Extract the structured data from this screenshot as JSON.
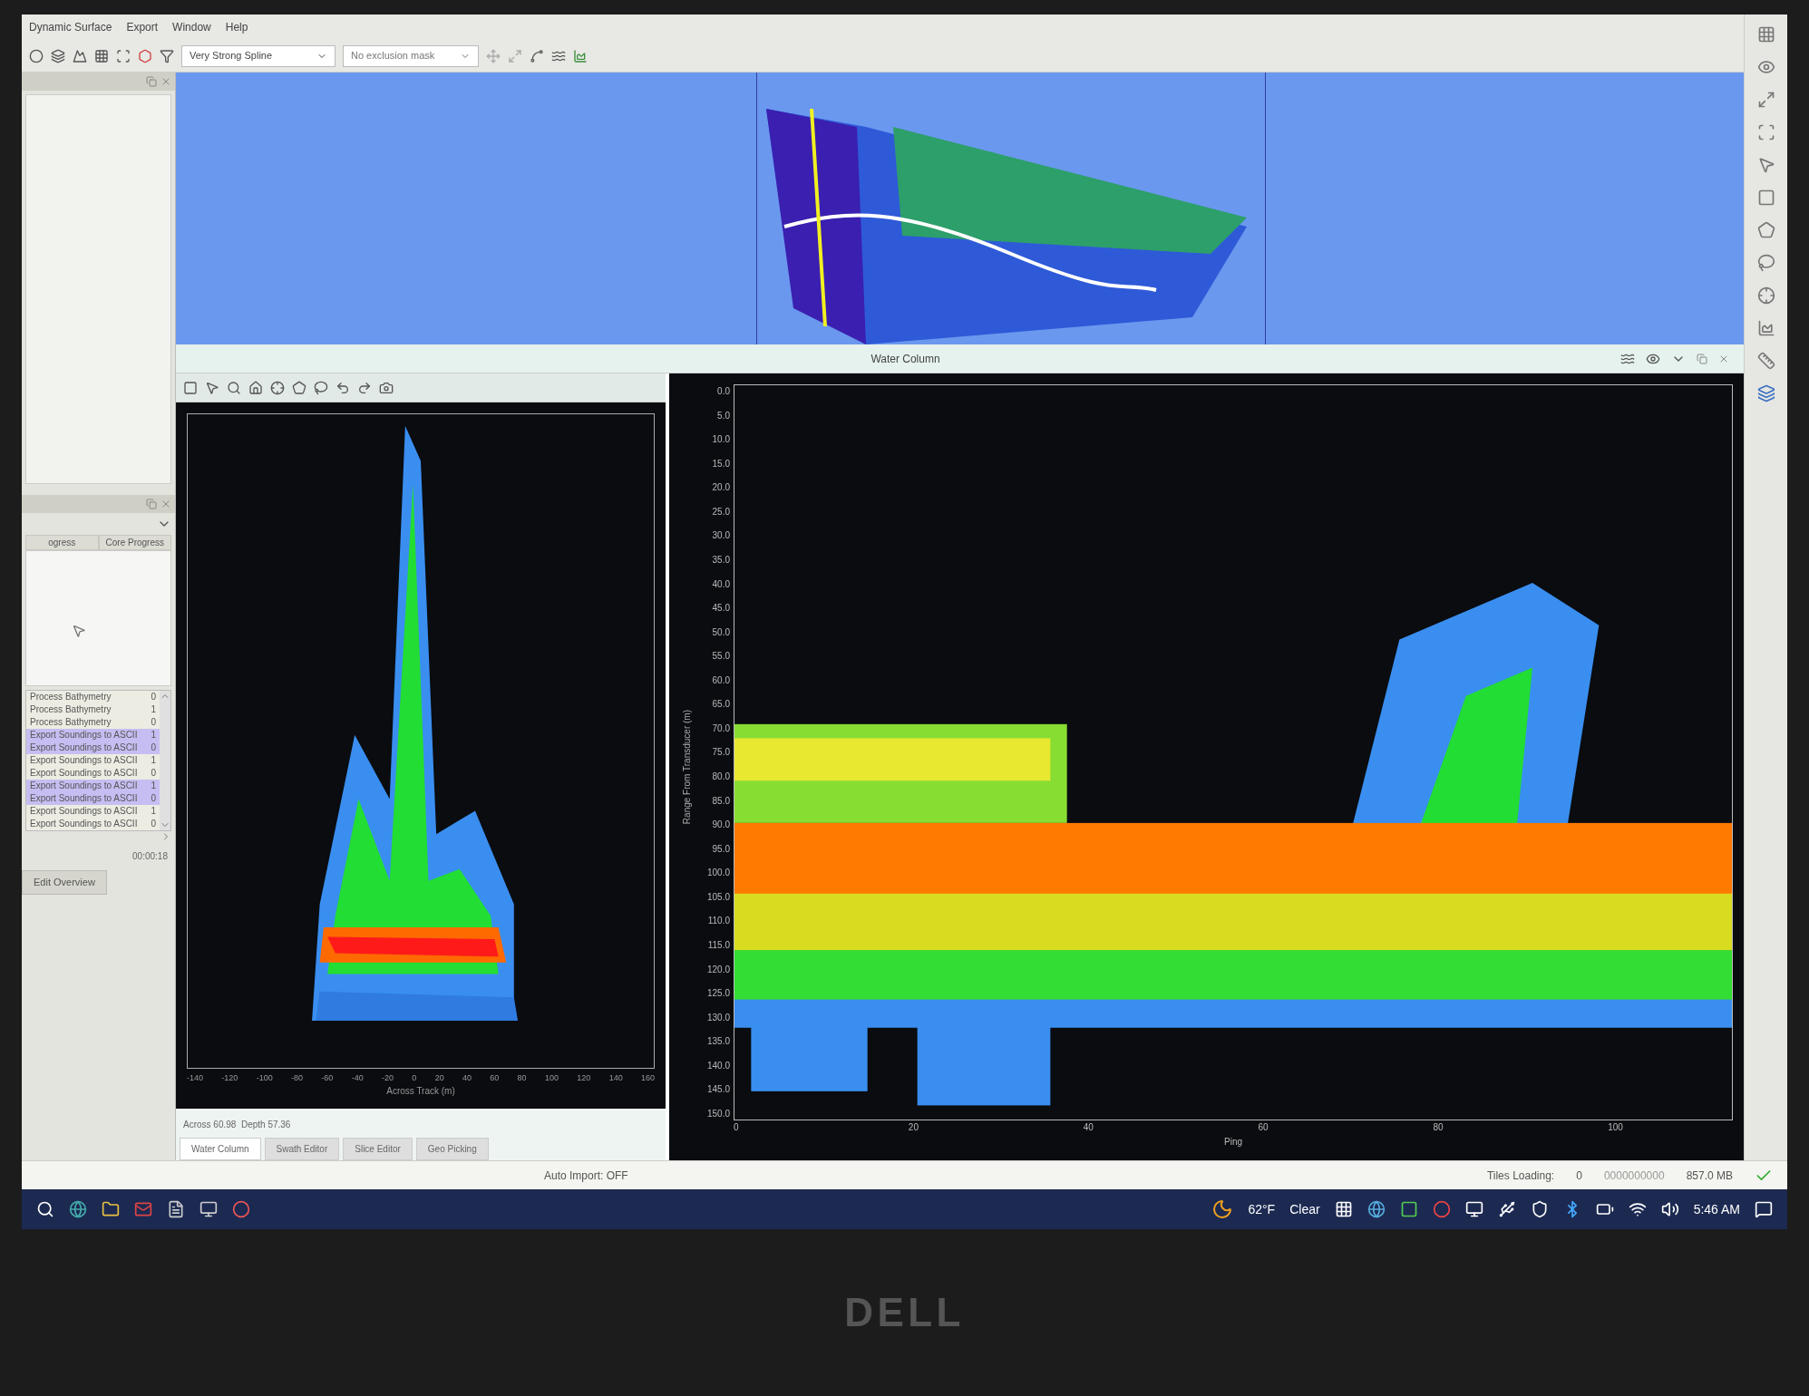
{
  "menu": [
    "Dynamic Surface",
    "Export",
    "Window",
    "Help"
  ],
  "toolbar": {
    "surface_filter": "Very Strong Spline",
    "exclusion_mask": "No exclusion mask"
  },
  "sidebar": {
    "columns": [
      "ogress",
      "Core Progress"
    ],
    "jobs": [
      {
        "name": "Process Bathymetry",
        "value": "0",
        "selected": false
      },
      {
        "name": "Process Bathymetry",
        "value": "1",
        "selected": false
      },
      {
        "name": "Process Bathymetry",
        "value": "0",
        "selected": false
      },
      {
        "name": "Export Soundings to ASCII",
        "value": "1",
        "selected": true
      },
      {
        "name": "Export Soundings to ASCII",
        "value": "0",
        "selected": true
      },
      {
        "name": "Export Soundings to ASCII",
        "value": "1",
        "selected": false
      },
      {
        "name": "Export Soundings to ASCII",
        "value": "0",
        "selected": false
      },
      {
        "name": "Export Soundings to ASCII",
        "value": "1",
        "selected": true
      },
      {
        "name": "Export Soundings to ASCII",
        "value": "0",
        "selected": true
      },
      {
        "name": "Export Soundings to ASCII",
        "value": "1",
        "selected": false
      },
      {
        "name": "Export Soundings to ASCII",
        "value": "0",
        "selected": false
      }
    ],
    "elapsed": "00:00:18",
    "tab": "Edit Overview"
  },
  "water_column": {
    "title": "Water Column",
    "fan_view": {
      "x_ticks": [
        "-140",
        "-120",
        "-100",
        "-80",
        "-60",
        "-40",
        "-20",
        "0",
        "20",
        "40",
        "60",
        "80",
        "100",
        "120",
        "140",
        "160"
      ],
      "x_label": "Across Track (m)"
    },
    "readout": "Across 60.98  Depth 57.36",
    "tabs": [
      {
        "label": "Water Column",
        "selected": true
      },
      {
        "label": "Swath Editor",
        "selected": false
      },
      {
        "label": "Slice Editor",
        "selected": false
      },
      {
        "label": "Geo Picking",
        "selected": false
      }
    ],
    "echogram": {
      "y_label": "Range From Transducer (m)",
      "y_ticks": [
        "0.0",
        "5.0",
        "10.0",
        "15.0",
        "20.0",
        "25.0",
        "30.0",
        "35.0",
        "40.0",
        "45.0",
        "50.0",
        "55.0",
        "60.0",
        "65.0",
        "70.0",
        "75.0",
        "80.0",
        "85.0",
        "90.0",
        "95.0",
        "100.0",
        "105.0",
        "110.0",
        "115.0",
        "120.0",
        "125.0",
        "130.0",
        "135.0",
        "140.0",
        "145.0",
        "150.0"
      ],
      "x_ticks": [
        "0",
        "20",
        "40",
        "60",
        "80",
        "100"
      ],
      "x_label": "Ping"
    }
  },
  "status_bar": {
    "auto_import": "Auto Import: OFF",
    "tiles_label": "Tiles Loading:",
    "tiles_count": "0",
    "digits": "0000000000",
    "memory": "857.0 MB"
  },
  "taskbar": {
    "temperature": "62°F",
    "weather": "Clear",
    "time": "5:46 AM"
  },
  "laptop": {
    "logo": "DELL"
  }
}
